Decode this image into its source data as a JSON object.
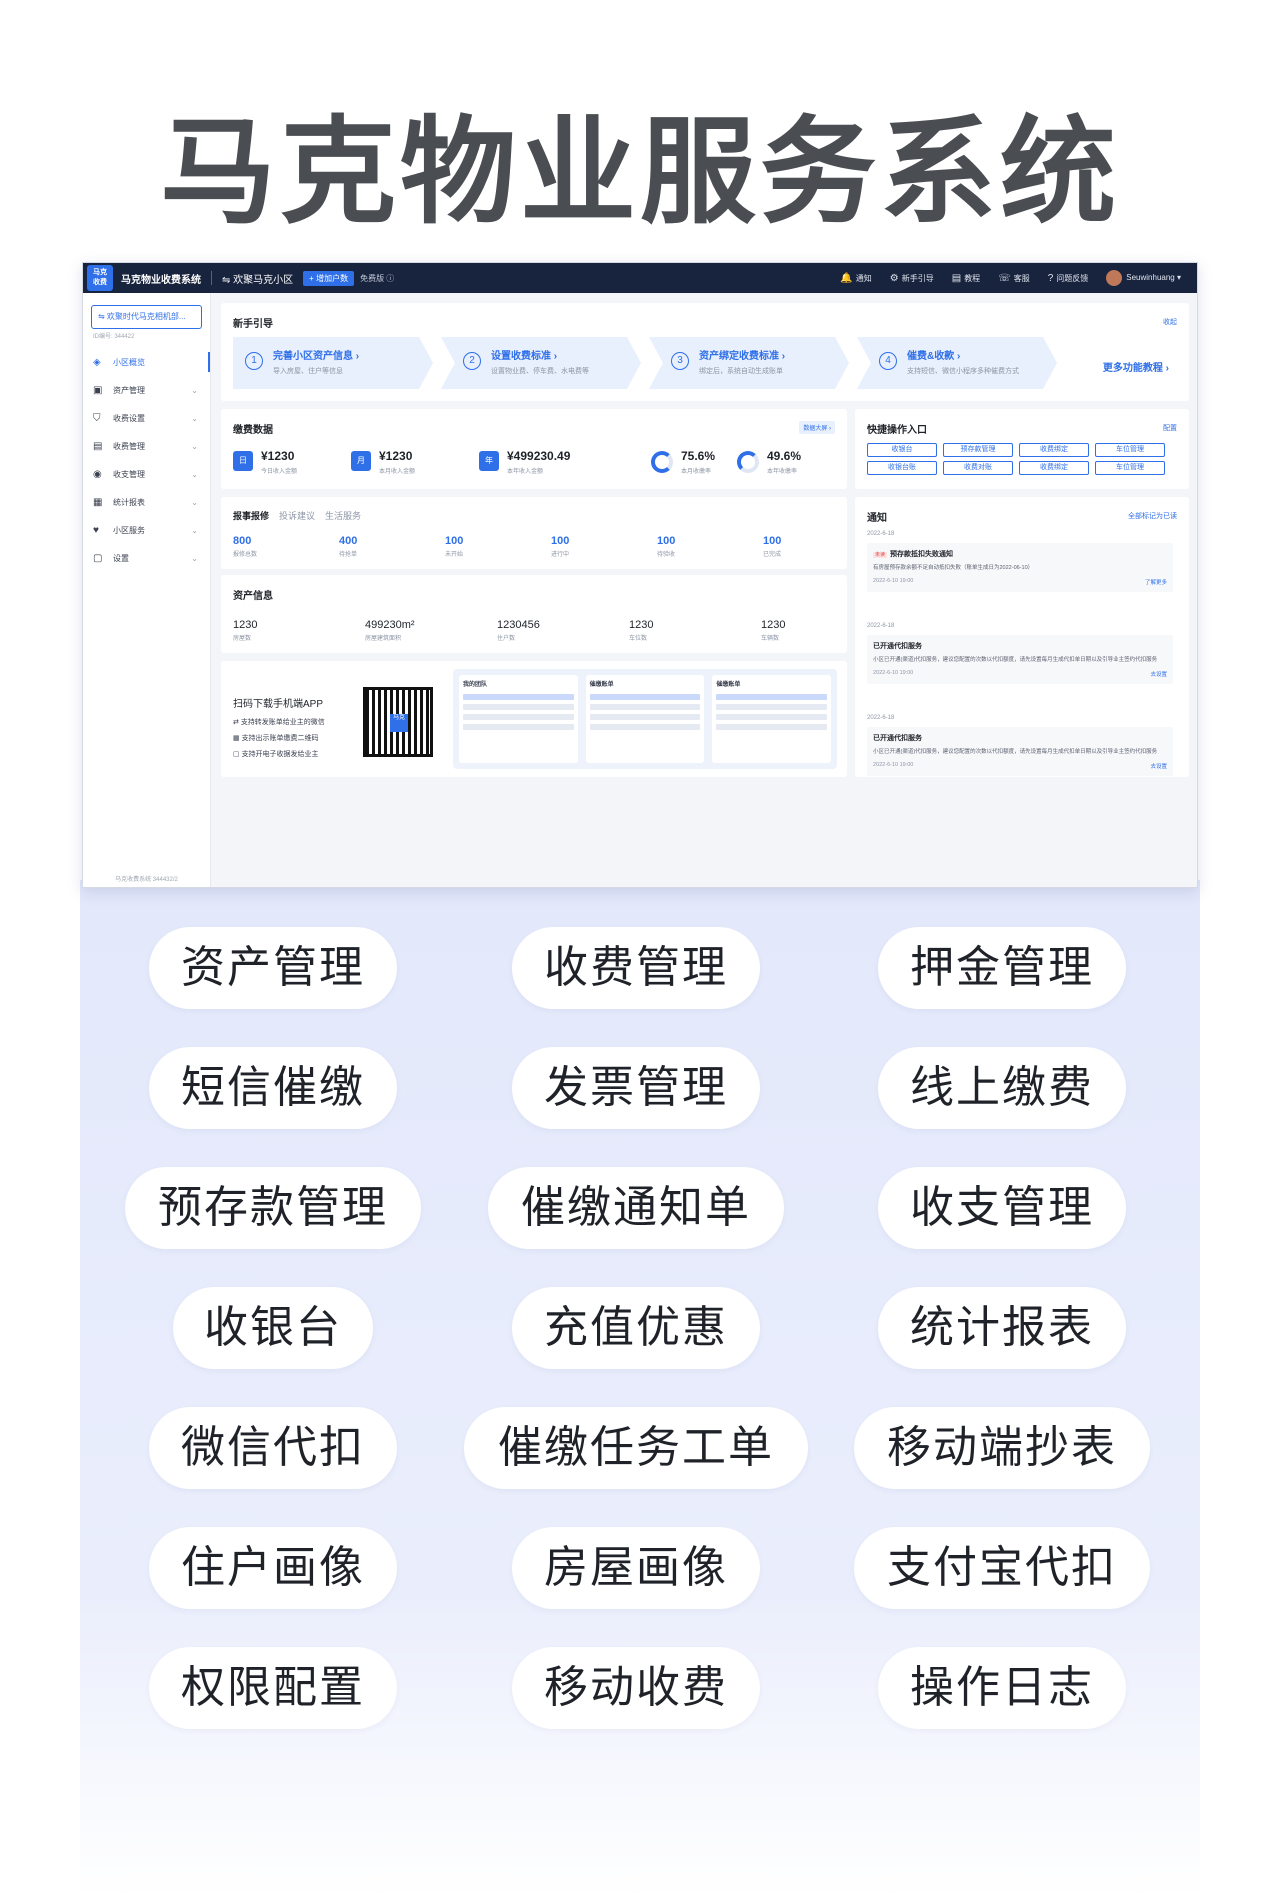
{
  "hero": {
    "title": "马克物业服务系统"
  },
  "topbar": {
    "logo": "马克\n收费系统",
    "app_name": "马克物业收费系统",
    "community": "⇋ 欢聚马克小区",
    "add_button": "+ 增加户数",
    "plan": "免费版 ⓘ",
    "items": [
      {
        "icon": "bell-icon",
        "glyph": "🔔",
        "label": "通知"
      },
      {
        "icon": "guide-icon",
        "glyph": "⚙",
        "label": "新手引导"
      },
      {
        "icon": "book-icon",
        "glyph": "▤",
        "label": "教程"
      },
      {
        "icon": "headset-icon",
        "glyph": "☏",
        "label": "客服"
      },
      {
        "icon": "help-icon",
        "glyph": "?",
        "label": "问题反馈"
      }
    ],
    "user": "Seuwinhuang ▾"
  },
  "sidebar": {
    "org_button": "⇋ 欢聚时代马克相机部...",
    "org_id": "ID编号: 344422",
    "items": [
      {
        "label": "小区概览",
        "glyph": "◈",
        "active": true
      },
      {
        "label": "资产管理",
        "glyph": "▣"
      },
      {
        "label": "收费设置",
        "glyph": "⛉"
      },
      {
        "label": "收费管理",
        "glyph": "▤"
      },
      {
        "label": "收支管理",
        "glyph": "◉"
      },
      {
        "label": "统计报表",
        "glyph": "▦"
      },
      {
        "label": "小区服务",
        "glyph": "♥"
      },
      {
        "label": "设置",
        "glyph": "▢"
      }
    ],
    "footer": "马克收费系统 344432/2"
  },
  "guide": {
    "title": "新手引导",
    "collapse": "收起",
    "steps": [
      {
        "num": "1",
        "title": "完善小区资产信息 ›",
        "desc": "导入房屋、住户等信息"
      },
      {
        "num": "2",
        "title": "设置收费标准 ›",
        "desc": "设置物业费、停车费、水电费等"
      },
      {
        "num": "3",
        "title": "资产绑定收费标准 ›",
        "desc": "绑定后，系统自动生成账单"
      },
      {
        "num": "4",
        "title": "催费&收款 ›",
        "desc": "支持短信、微信小程序多种催费方式"
      }
    ],
    "more": "更多功能教程 ›"
  },
  "payment": {
    "title": "缴费数据",
    "bigscreen": "数据大屏 ›",
    "stats": [
      {
        "badge": "日",
        "value": "¥1230",
        "label": "今日收入金额"
      },
      {
        "badge": "月",
        "value": "¥1230",
        "label": "本月收入金额"
      },
      {
        "badge": "年",
        "value": "¥499230.49",
        "label": "本年收入金额"
      }
    ],
    "rates": [
      {
        "value": "75.6%",
        "label": "本月收缴率",
        "fraction": 0.756
      },
      {
        "value": "49.6%",
        "label": "本年收缴率",
        "fraction": 0.496
      }
    ]
  },
  "quick": {
    "title": "快捷操作入口",
    "config": "配置",
    "buttons": [
      "收银台",
      "预存款管理",
      "收费绑定",
      "车位管理",
      "收银台账",
      "收费对账",
      "收费绑定",
      "车位管理"
    ]
  },
  "repair": {
    "tabs": [
      "报事报修",
      "投诉建议",
      "生活服务"
    ],
    "stats": [
      {
        "value": "800",
        "label": "报修总数"
      },
      {
        "value": "400",
        "label": "待抢单"
      },
      {
        "value": "100",
        "label": "未开始"
      },
      {
        "value": "100",
        "label": "进行中"
      },
      {
        "value": "100",
        "label": "待验收"
      },
      {
        "value": "100",
        "label": "已完成"
      }
    ]
  },
  "asset": {
    "title": "资产信息",
    "stats": [
      {
        "value": "1230",
        "label": "房屋数"
      },
      {
        "value": "499230m²",
        "label": "房屋建筑面积"
      },
      {
        "value": "1230456",
        "label": "住户数"
      },
      {
        "value": "1230",
        "label": "车位数"
      },
      {
        "value": "1230",
        "label": "车辆数"
      }
    ]
  },
  "download": {
    "title": "扫码下载手机端APP",
    "features": [
      "支持转发账单给业主的微信",
      "支持出示账单缴费二维码",
      "支持开电子收据发给业主"
    ],
    "qr_center": "马克",
    "phones": [
      "我的团队",
      "催缴账单",
      "催缴账单"
    ]
  },
  "notice": {
    "title": "通知",
    "mark_all": "全部标记为已读",
    "items": [
      {
        "date": "2022-6-18",
        "tag": "未读",
        "title": "预存款抵扣失败通知",
        "text": "有房屋预存款余额不足自动抵扣失败（账单生成日为2022-06-10）",
        "time": "2022-6-10 19:00",
        "action": "了解更多"
      },
      {
        "date": "2022-6-18",
        "tag": "",
        "title": "已开通代扣服务",
        "text": "小区已开通(渠道)代扣服务，建议您配置的次数以代扣额度，请先设置每月生成代扣单日期以及引导业主签约代扣服务",
        "time": "2022-6-10 19:00",
        "action": "去设置"
      },
      {
        "date": "2022-6-18",
        "tag": "",
        "title": "已开通代扣服务",
        "text": "小区已开通(渠道)代扣服务，建议您配置的次数以代扣额度，请先设置每月生成代扣单日期以及引导业主签约代扣服务",
        "time": "2022-6-10 19:00",
        "action": "去设置"
      }
    ]
  },
  "features": [
    [
      "资产管理",
      "收费管理",
      "押金管理"
    ],
    [
      "短信催缴",
      "发票管理",
      "线上缴费"
    ],
    [
      "预存款管理",
      "催缴通知单",
      "收支管理"
    ],
    [
      "收银台",
      "充值优惠",
      "统计报表"
    ],
    [
      "微信代扣",
      "催缴任务工单",
      "移动端抄表"
    ],
    [
      "住户画像",
      "房屋画像",
      "支付宝代扣"
    ],
    [
      "权限配置",
      "移动收费",
      "操作日志"
    ]
  ]
}
